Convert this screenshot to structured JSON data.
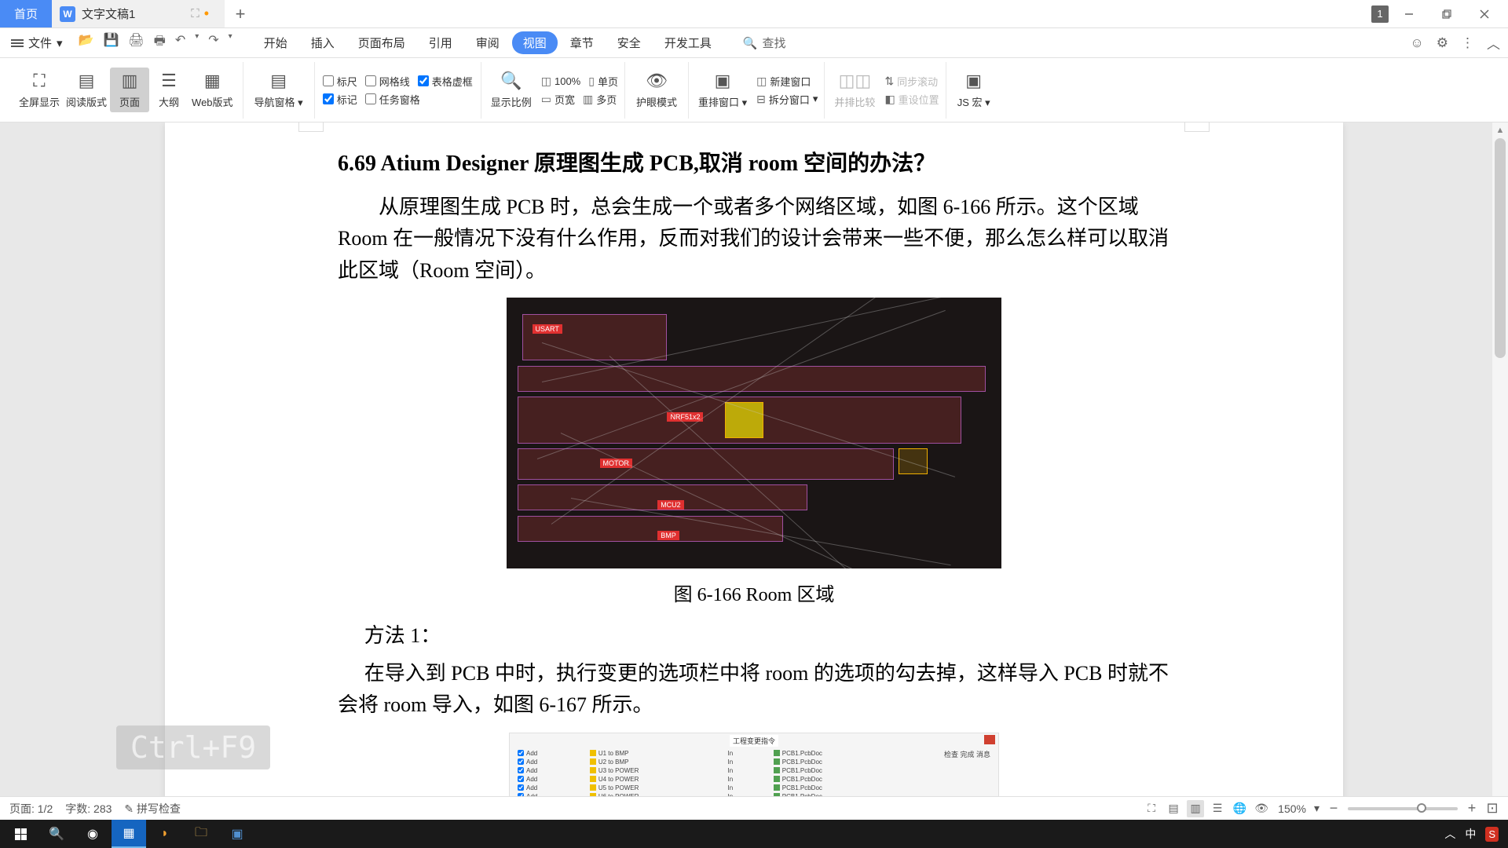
{
  "titlebar": {
    "home_tab": "首页",
    "doc_tab": "文字文稿1",
    "badge": "1"
  },
  "menubar": {
    "file": "文件",
    "tabs": [
      "开始",
      "插入",
      "页面布局",
      "引用",
      "审阅",
      "视图",
      "章节",
      "安全",
      "开发工具"
    ],
    "active_tab_index": 5,
    "search": "查找"
  },
  "ribbon": {
    "fullscreen": "全屏显示",
    "reading": "阅读版式",
    "page": "页面",
    "outline": "大纲",
    "web": "Web版式",
    "navpane": "导航窗格",
    "ruler": "标尺",
    "gridlines": "网格线",
    "tablebox": "表格虚框",
    "markup": "标记",
    "taskpane": "任务窗格",
    "zoom": "显示比例",
    "pct100": "100%",
    "onepage": "单页",
    "pagewidth": "页宽",
    "multipage": "多页",
    "eyecare": "护眼模式",
    "rearrange": "重排窗口",
    "newwin": "新建窗口",
    "splitwin": "拆分窗口",
    "sidebyside": "并排比较",
    "syncscroll": "同步滚动",
    "resetpos": "重设位置",
    "jsmacro": "JS 宏"
  },
  "document": {
    "heading": "6.69  Atium Designer 原理图生成 PCB,取消 room 空间的办法？",
    "para1": "从原理图生成 PCB 时，总会生成一个或者多个网络区域，如图 6-166 所示。这个区域 Room 在一般情况下没有什么作用，反而对我们的设计会带来一些不便，那么怎么样可以取消此区域（Room 空间）。",
    "fig1_caption": "图 6-166    Room 区域",
    "method1_title": "方法 1：",
    "para2": "在导入到 PCB 中时，执行变更的选项栏中将 room 的选项的勾去掉，这样导入 PCB 时就不会将 room 导入，如图 6-167 所示。",
    "pcb_labels": {
      "usart": "USART",
      "nrf": "NRF51x2",
      "motor": "MOTOR",
      "mcu": "MCU2",
      "bmp": "BMP"
    },
    "dlg_title": "工程变更指令"
  },
  "keystroke": "Ctrl+F9",
  "statusbar": {
    "page": "页面: 1/2",
    "words": "字数: 283",
    "spell": "拼写检查",
    "zoom_pct": "150%"
  },
  "taskbar": {
    "ime_cn": "中"
  }
}
